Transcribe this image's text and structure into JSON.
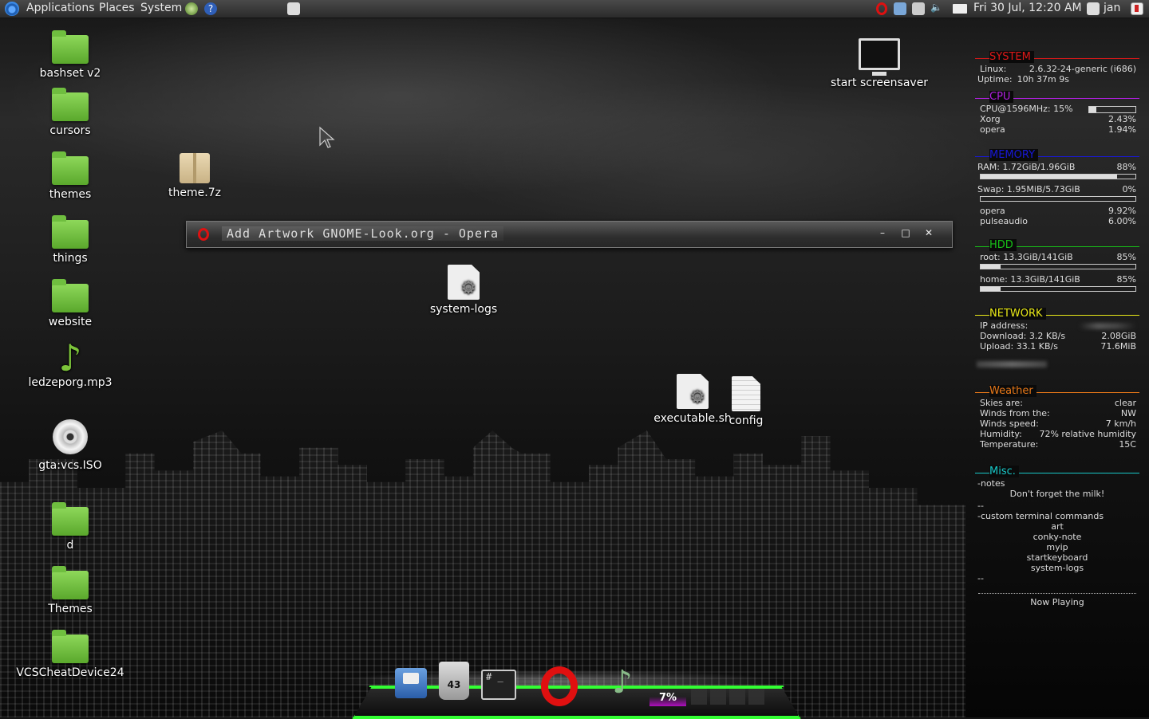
{
  "panel": {
    "menus": [
      "Applications",
      "Places",
      "System"
    ],
    "clock": "Fri 30 Jul, 12:20 AM",
    "user": "jan"
  },
  "desktop_icons_left": [
    {
      "label": "bashset v2",
      "type": "folder"
    },
    {
      "label": "cursors",
      "type": "folder"
    },
    {
      "label": "themes",
      "type": "folder"
    },
    {
      "label": "things",
      "type": "folder"
    },
    {
      "label": "website",
      "type": "folder"
    },
    {
      "label": "ledzeporg.mp3",
      "type": "audio"
    },
    {
      "label": "gta:vcs.ISO",
      "type": "disc"
    },
    {
      "label": "d",
      "type": "folder"
    },
    {
      "label": "Themes",
      "type": "folder"
    },
    {
      "label": "VCSCheatDevice24",
      "type": "folder"
    }
  ],
  "desktop_icons_other": {
    "theme7z": "theme.7z",
    "screensaver": "start screensaver",
    "system_logs": "system-logs",
    "executable": "executable.sh",
    "config": "config"
  },
  "window": {
    "title": "Add Artwork GNOME-Look.org - Opera",
    "minimize": "–",
    "maximize": "□",
    "close": "✕"
  },
  "dock": {
    "trash_count": "43",
    "terminal_glyph": "# _",
    "cpu_percent": "7%"
  },
  "conky": {
    "system": {
      "title": "SYSTEM",
      "linux_label": "Linux:",
      "linux_value": "2.6.32-24-generic (i686)",
      "uptime_label": "Uptime:",
      "uptime_value": "10h 37m 9s"
    },
    "cpu": {
      "title": "CPU",
      "freq_label": "CPU@1596MHz: 15%",
      "usage": 0.15,
      "procs": [
        {
          "name": "Xorg",
          "value": "2.43%"
        },
        {
          "name": "opera",
          "value": "1.94%"
        }
      ]
    },
    "memory": {
      "title": "MEMORY",
      "ram_label": "RAM: 1.72GiB/1.96GiB",
      "ram_pct": "88%",
      "ram_usage": 0.88,
      "swap_label": "Swap: 1.95MiB/5.73GiB",
      "swap_pct": "0%",
      "swap_usage": 0.0,
      "procs": [
        {
          "name": "opera",
          "value": "9.92%"
        },
        {
          "name": "pulseaudio",
          "value": "6.00%"
        }
      ]
    },
    "hdd": {
      "title": "HDD",
      "root_label": "root: 13.3GiB/141GiB",
      "root_pct": "85%",
      "root_usage": 0.13,
      "home_label": "home: 13.3GiB/141GiB",
      "home_pct": "85%",
      "home_usage": 0.13
    },
    "network": {
      "title": "NETWORK",
      "ip_label": "IP address:",
      "down_label": "Download: 3.2 KB/s",
      "down_total": "2.08GiB",
      "up_label": "Upload: 33.1 KB/s",
      "up_total": "71.6MiB"
    },
    "weather": {
      "title": "Weather",
      "rows": [
        {
          "label": "Skies are:",
          "value": "clear"
        },
        {
          "label": "Winds from the:",
          "value": "NW"
        },
        {
          "label": "Winds speed:",
          "value": "7 km/h"
        },
        {
          "label": "Humidity:",
          "value": "72% relative humidity"
        },
        {
          "label": "Temperature:",
          "value": "15C"
        }
      ]
    },
    "misc": {
      "title": "Misc.",
      "notes_label": "-notes",
      "note_text": "Don't forget the milk!",
      "sep1": "--",
      "commands_label": "-custom terminal commands",
      "commands": [
        "art",
        "conky-note",
        "myip",
        "startkeyboard",
        "system-logs"
      ],
      "sep2": "--",
      "now_playing": "Now Playing"
    }
  },
  "colors": {
    "system": "#e01818",
    "cpu": "#b020e0",
    "memory": "#1818d8",
    "hdd": "#18c018",
    "network": "#e8e818",
    "weather": "#e87818",
    "misc": "#18c8c8",
    "dock_border": "#33ff33"
  }
}
